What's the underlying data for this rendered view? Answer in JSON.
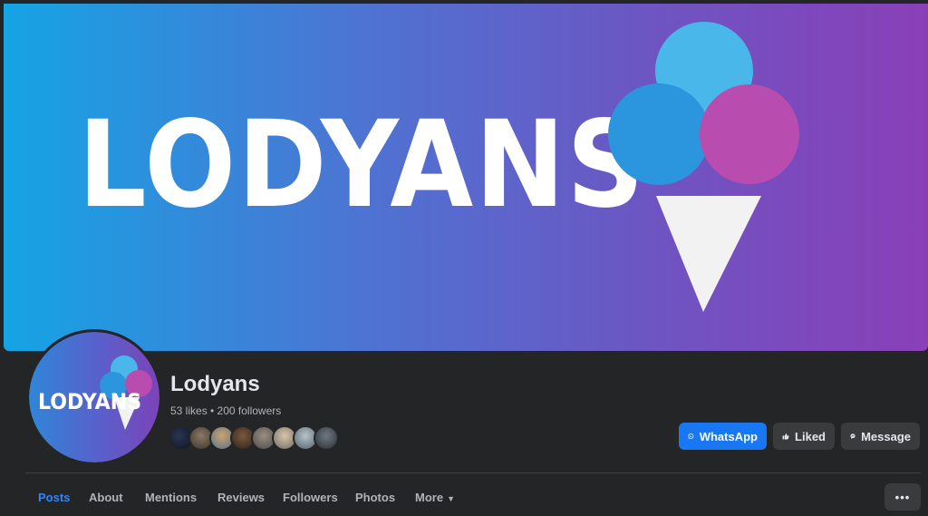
{
  "cover": {
    "logo_text": "LODYANS"
  },
  "profile": {
    "avatar_logo_text": "LODYANS",
    "name": "Lodyans",
    "stats": "53 likes • 200 followers"
  },
  "actions": {
    "whatsapp_label": "WhatsApp",
    "liked_label": "Liked",
    "message_label": "Message",
    "overflow_label": "•••"
  },
  "tabs": [
    {
      "label": "Posts",
      "active": true
    },
    {
      "label": "About",
      "active": false
    },
    {
      "label": "Mentions",
      "active": false
    },
    {
      "label": "Reviews",
      "active": false
    },
    {
      "label": "Followers",
      "active": false
    },
    {
      "label": "Photos",
      "active": false
    },
    {
      "label": "More",
      "active": false
    }
  ],
  "colors": {
    "accent": "#1877f2",
    "active_tab": "#2d88ff",
    "background": "#242526",
    "scoop_light_blue": "#4ab7ea",
    "scoop_blue": "#2b96dd",
    "scoop_pink": "#b84daf"
  },
  "icons": {
    "whatsapp": "whatsapp-icon",
    "liked": "thumbs-up-icon",
    "message": "messenger-icon",
    "more": "caret-down-icon"
  }
}
